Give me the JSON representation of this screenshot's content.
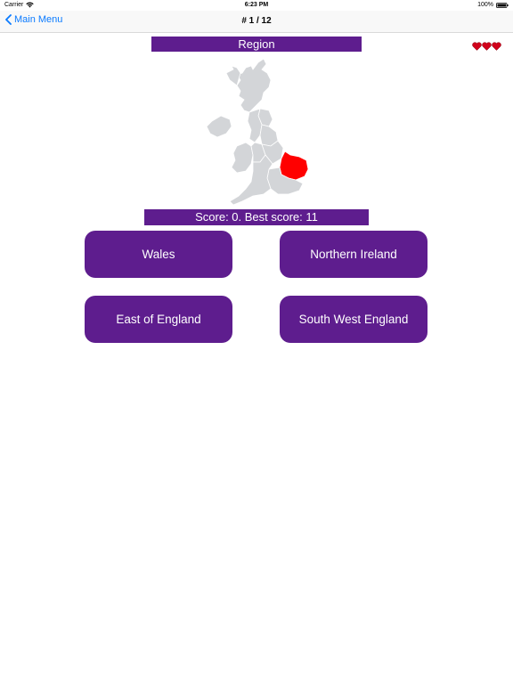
{
  "status_bar": {
    "carrier": "Carrier",
    "time": "6:23 PM",
    "battery": "100%",
    "icons": [
      "wifi-icon",
      "battery-icon"
    ]
  },
  "nav": {
    "back_label": "Main Menu",
    "back_icon": "chevron-left-icon",
    "title": "# 1 / 12"
  },
  "quiz": {
    "question_label": "Region",
    "lives": 3,
    "life_icon": "heart-icon",
    "map_icon": "uk-map-icon",
    "highlight_color": "#ff0000",
    "map_color": "#d3d5d8",
    "score_text": "Score: 0. Best score: 11"
  },
  "answers": [
    {
      "label": "Wales"
    },
    {
      "label": "Northern Ireland"
    },
    {
      "label": "East of England"
    },
    {
      "label": "South West England"
    }
  ],
  "theme": {
    "accent": "#5e1d8e",
    "link": "#0a7aff"
  }
}
